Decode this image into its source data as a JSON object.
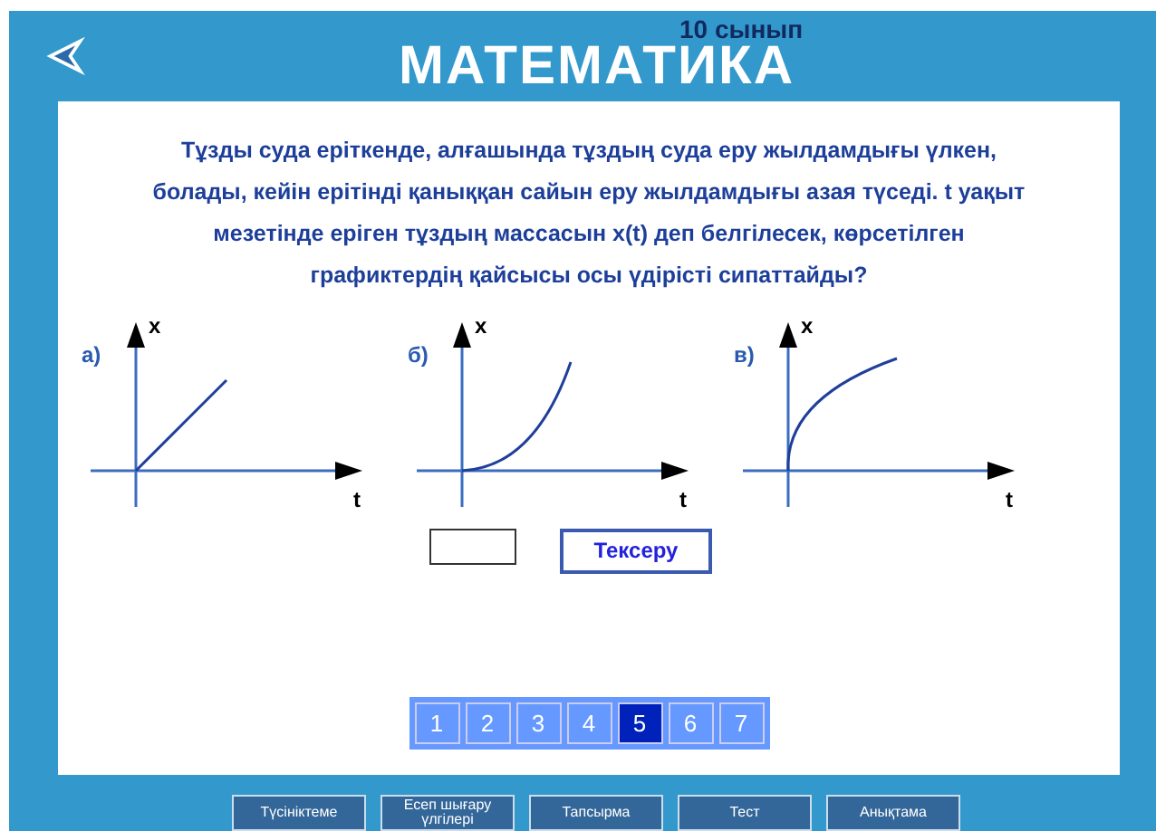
{
  "header": {
    "title": "МАТЕМАТИКА",
    "grade": "10 сынып"
  },
  "question": "Тұзды суда еріткенде, алғашында тұздың суда еру жылдамдығы  үлкен, болады, кейін ерітінді қаныққан сайын еру жылдамдығы азая түседі. t уақыт мезетінде еріген тұздың  массасын x(t) деп белгілесек, көрсетілген графиктердің қайсысы осы үдірісті сипаттайды?",
  "graphs": [
    {
      "label": "а)",
      "kind": "linear",
      "y_axis": "x",
      "x_axis": "t"
    },
    {
      "label": "б)",
      "kind": "convex",
      "y_axis": "x",
      "x_axis": "t"
    },
    {
      "label": "в)",
      "kind": "concave",
      "y_axis": "x",
      "x_axis": "t"
    }
  ],
  "check_button": "Тексеру",
  "pages": [
    {
      "label": "1",
      "selected": false
    },
    {
      "label": "2",
      "selected": false
    },
    {
      "label": "3",
      "selected": false
    },
    {
      "label": "4",
      "selected": false
    },
    {
      "label": "5",
      "selected": true
    },
    {
      "label": "6",
      "selected": false
    },
    {
      "label": "7",
      "selected": false
    }
  ],
  "bottom_tabs": [
    "Түсініктеме",
    "Есеп шығару үлгілері",
    "Тапсырма",
    "Тест",
    "Анықтама"
  ]
}
